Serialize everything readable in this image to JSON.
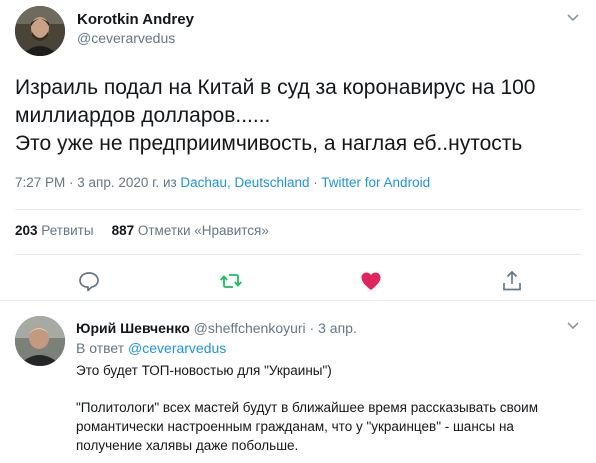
{
  "main_tweet": {
    "author_name": "Korotkin Andrey",
    "author_handle": "@ceverarvedus",
    "text_lines": [
      "Израиль подал на Китай в суд за коронавирус на 100",
      "миллиардов долларов......",
      "Это уже не предприимчивость, а наглая еб..нутость"
    ],
    "meta": {
      "time": "7:27 PM",
      "sep1": " · ",
      "date": "3 апр. 2020 г.",
      "from_prefix": " из ",
      "location": "Dachau, Deutschland",
      "sep2": " · ",
      "source": "Twitter for Android"
    },
    "stats": {
      "retweets_count": "203",
      "retweets_label": "Ретвиты",
      "likes_count": "887",
      "likes_label": "Отметки «Нравится»"
    },
    "actions": {
      "reply_icon": "comment-icon",
      "retweet_icon": "retweet-icon",
      "like_icon": "heart-icon",
      "share_icon": "share-icon"
    }
  },
  "reply_tweet": {
    "author_name": "Юрий Шевченко",
    "author_handle": "@sheffchenkoyuri",
    "sep": " · ",
    "date": "3 апр.",
    "reply_to_prefix": "В ответ ",
    "reply_to_handle": "@ceverarvedus",
    "line1": "Это будет ТОП-новостью для \"Украины\")",
    "para_lines": [
      "\"Политологи\" всех мастей будут в ближайшее время рассказывать своим",
      "романтически настроенным гражданам, что у \"украинцев\" - шансы на",
      "получение халявы даже побольше."
    ]
  },
  "colors": {
    "text_primary": "#14171a",
    "text_secondary": "#657786",
    "link": "#1b95e0",
    "retweet_green": "#17bf63",
    "like_red": "#e0245e"
  }
}
